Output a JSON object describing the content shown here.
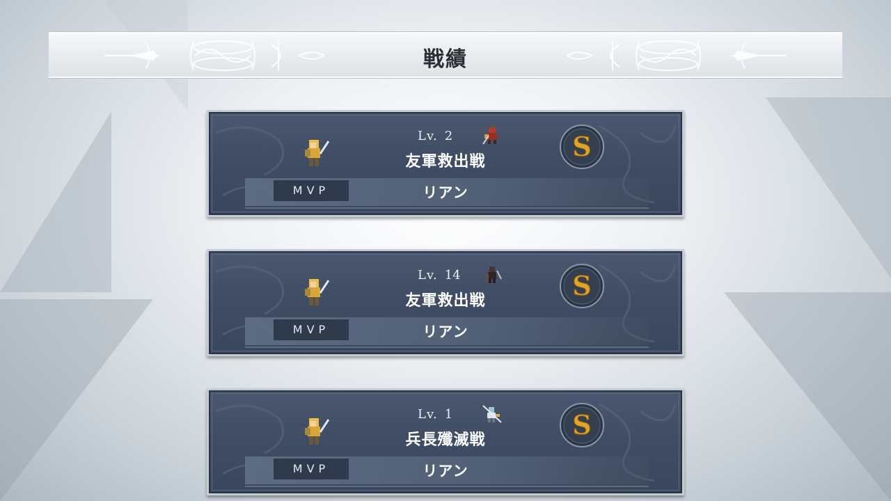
{
  "screen_title": "戦績",
  "records": [
    {
      "level_label": "Lv.",
      "level": "2",
      "battle_name": "友軍救出戦",
      "rank": "S",
      "mvp_label": "MVP",
      "mvp_name": "リアン",
      "enemy_icon": "red-soldier-sprite"
    },
    {
      "level_label": "Lv.",
      "level": "14",
      "battle_name": "友軍救出戦",
      "rank": "S",
      "mvp_label": "MVP",
      "mvp_name": "リアン",
      "enemy_icon": "dark-rogue-sprite"
    },
    {
      "level_label": "Lv.",
      "level": "1",
      "battle_name": "兵長殲滅戦",
      "rank": "S",
      "mvp_label": "MVP",
      "mvp_name": "リアン",
      "enemy_icon": "lancer-sprite"
    }
  ],
  "colors": {
    "card_bg": "#44526a",
    "rank_gold": "#e0a426",
    "title_text": "#2a2f36"
  }
}
